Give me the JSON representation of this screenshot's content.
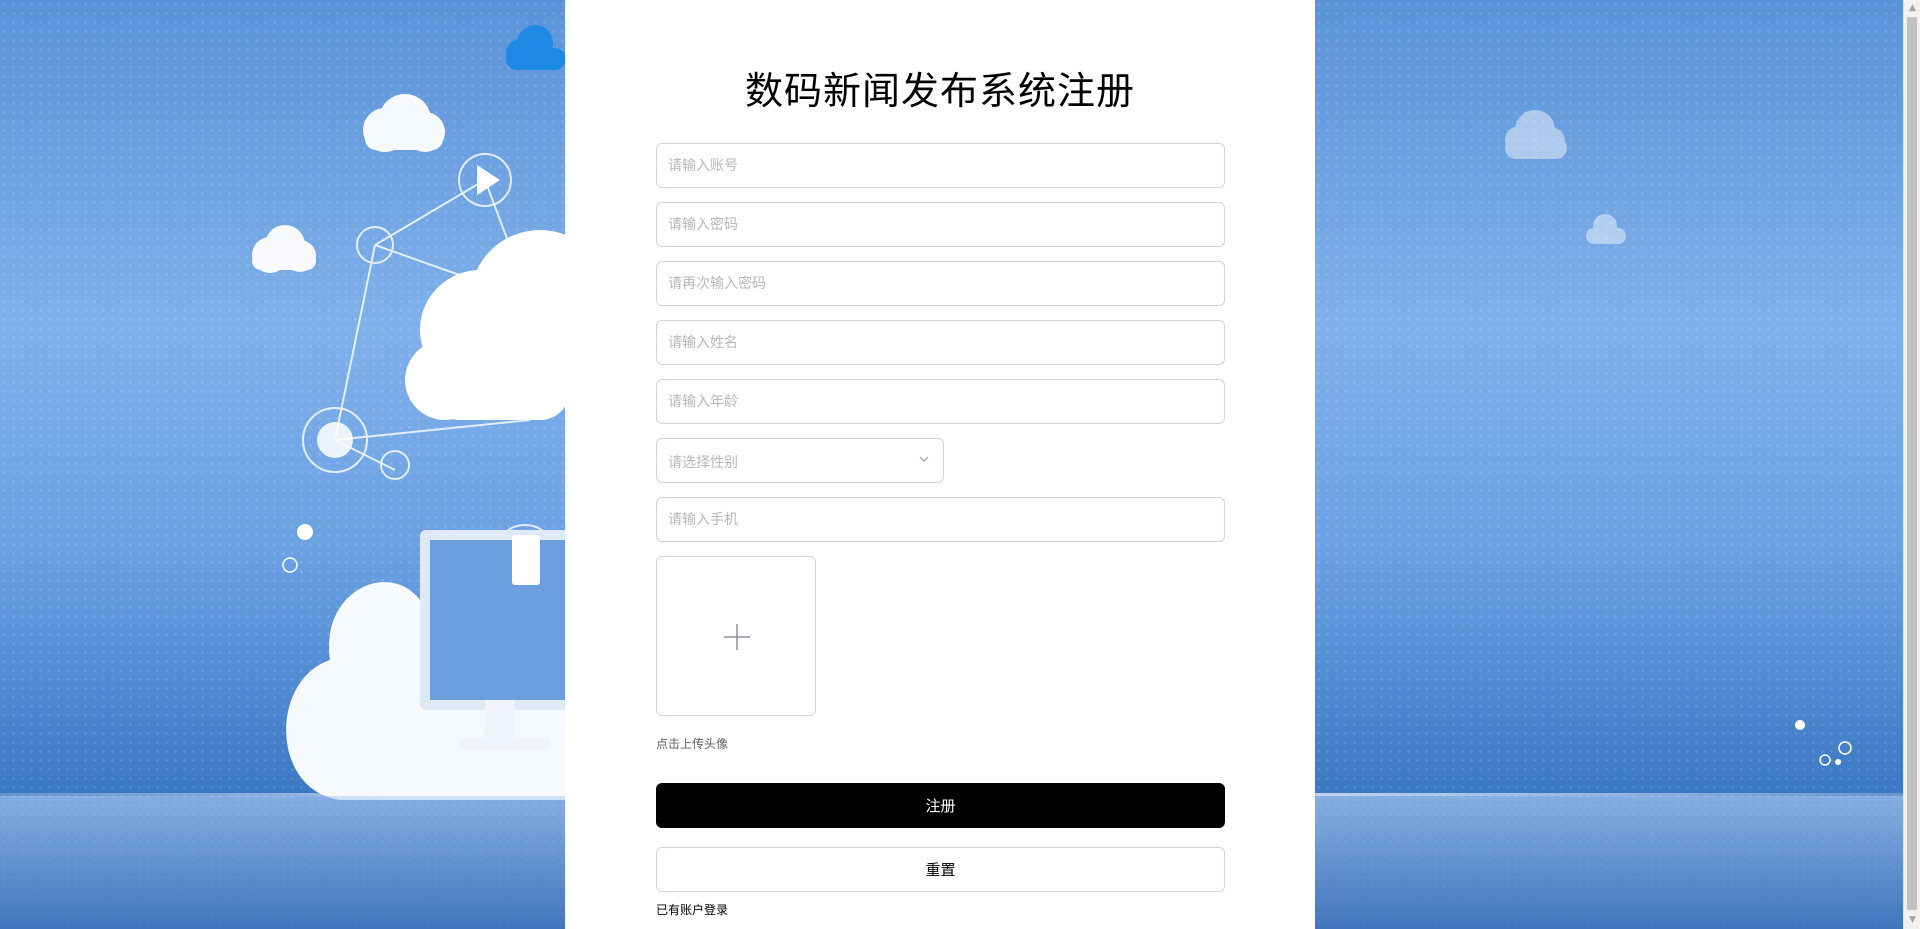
{
  "form": {
    "title": "数码新闻发布系统注册",
    "account_placeholder": "请输入账号",
    "password_placeholder": "请输入密码",
    "password_confirm_placeholder": "请再次输入密码",
    "name_placeholder": "请输入姓名",
    "age_placeholder": "请输入年龄",
    "gender_placeholder": "请选择性别",
    "phone_placeholder": "请输入手机",
    "upload_hint": "点击上传头像",
    "register_label": "注册",
    "reset_label": "重置",
    "login_link": "已有账户登录"
  },
  "icons": {
    "upload": "plus-icon",
    "select": "chevron-down-icon"
  },
  "colors": {
    "primary_button": "#000000",
    "background": "#6aa0e2",
    "panel": "#ffffff"
  }
}
